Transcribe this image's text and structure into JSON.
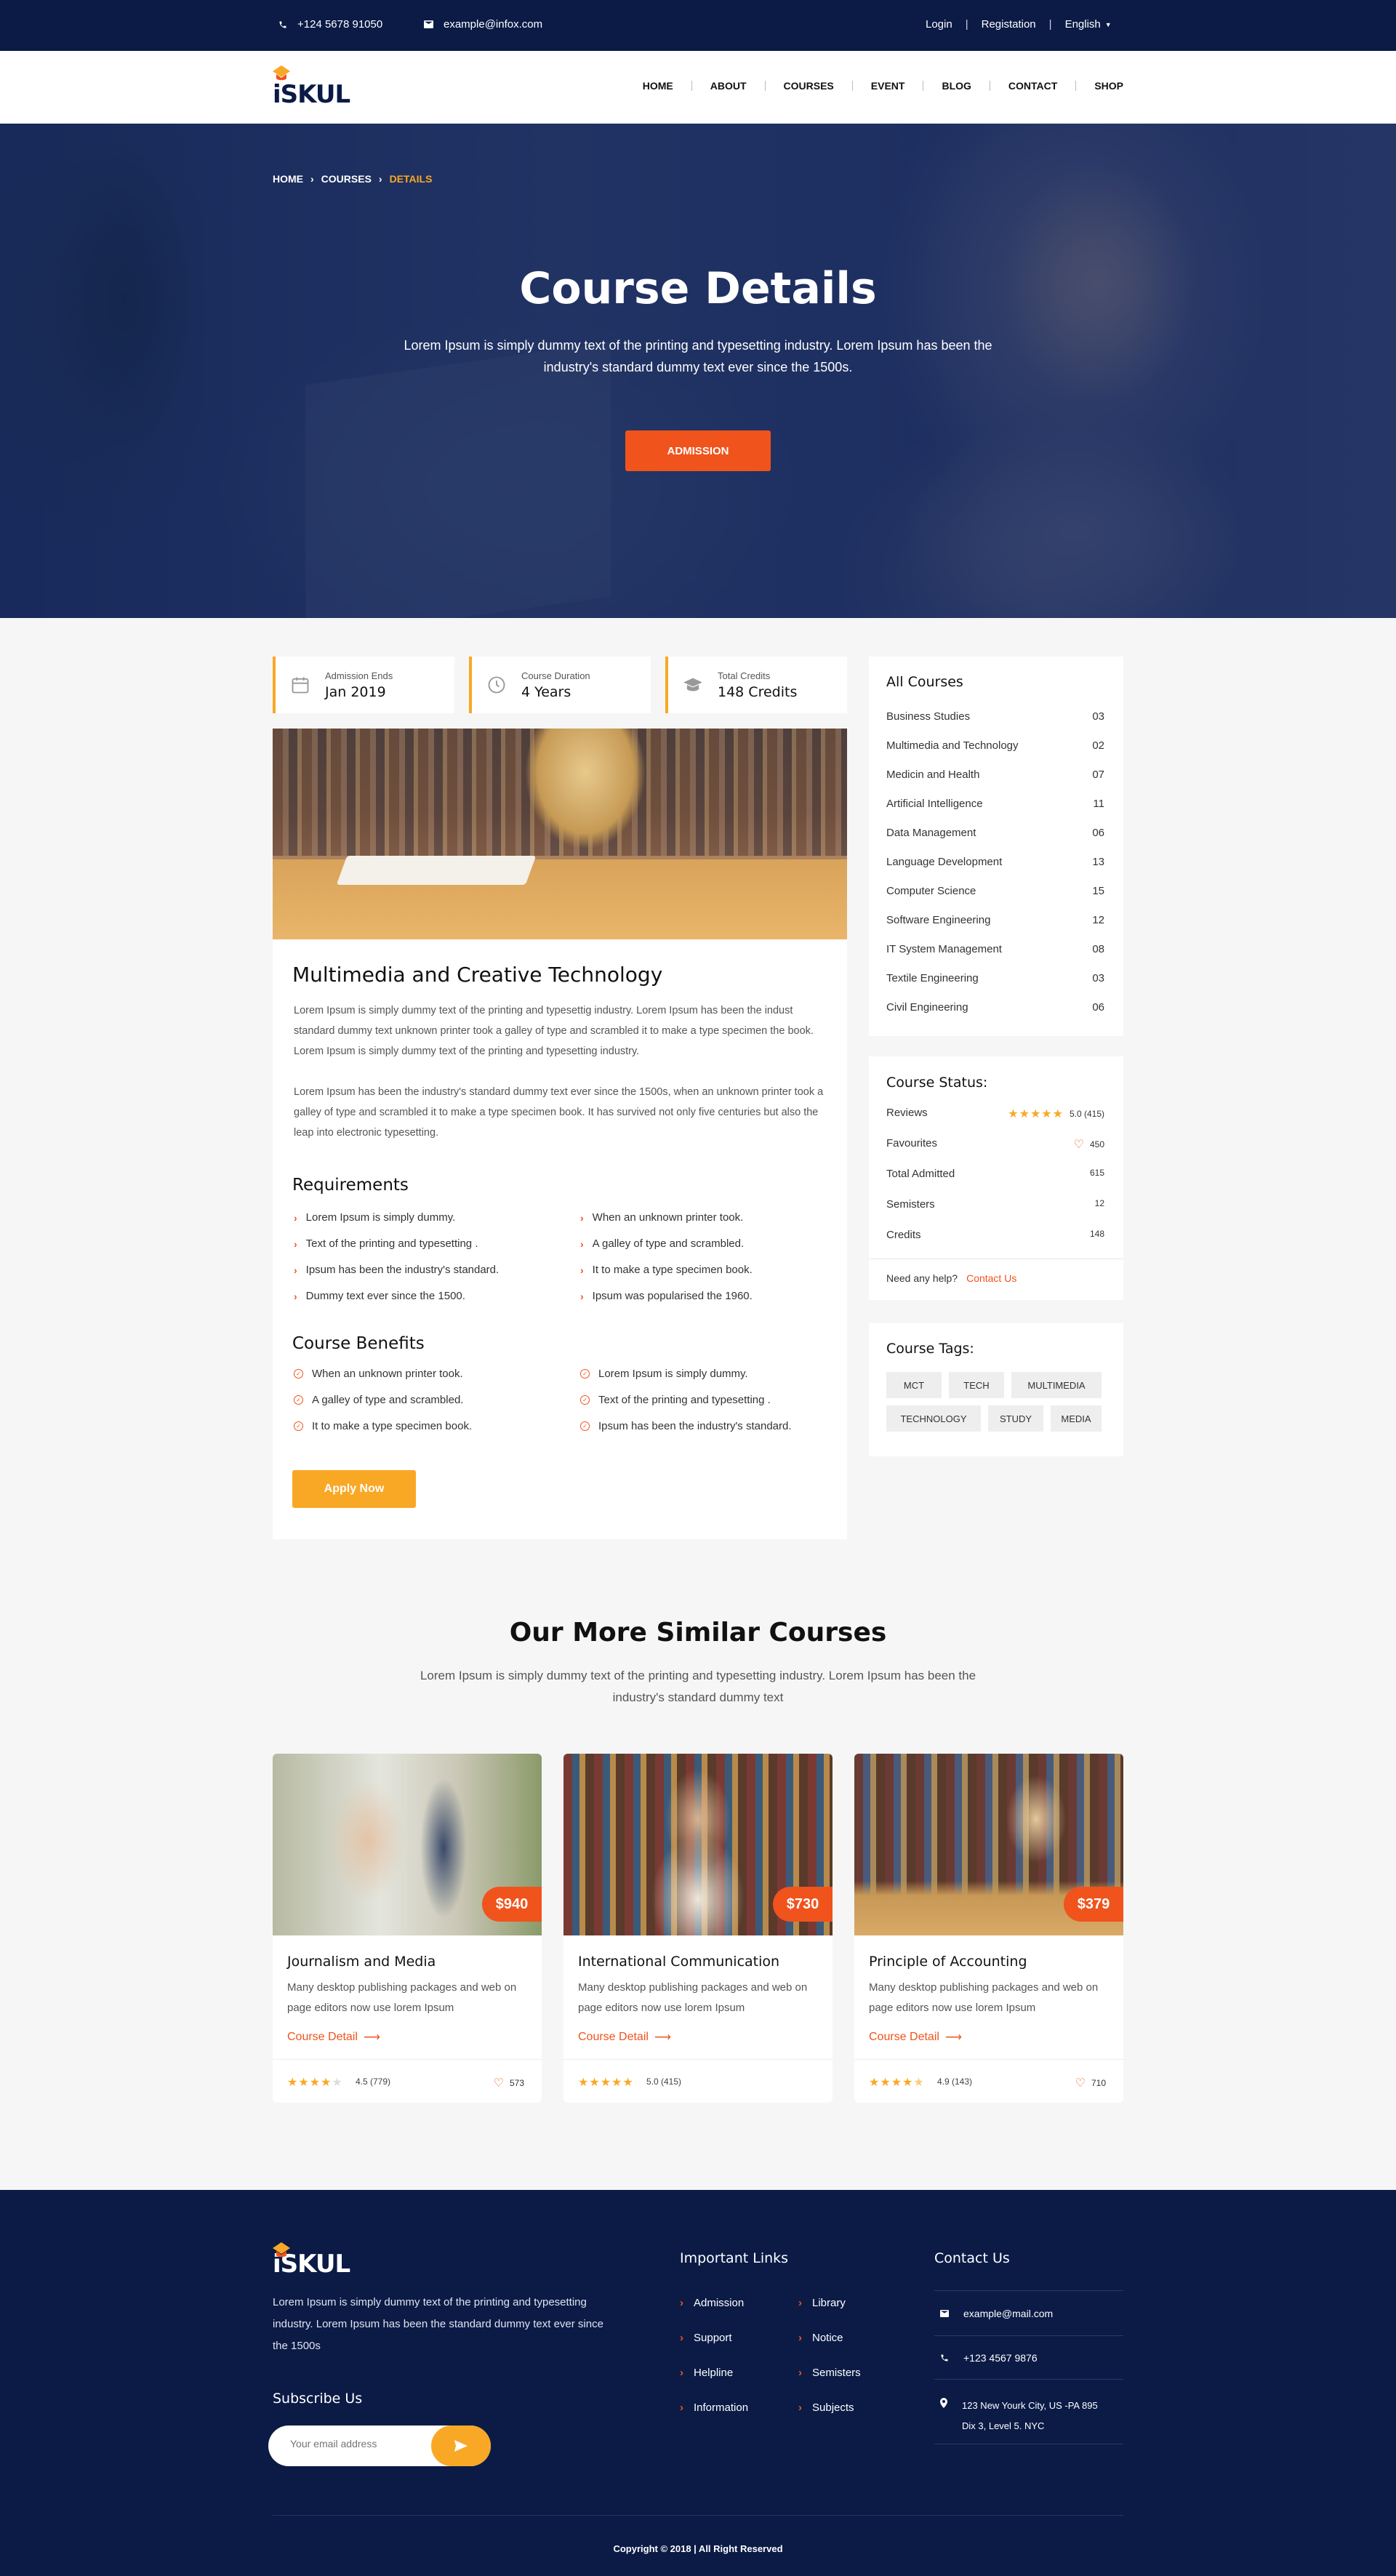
{
  "topbar": {
    "phone": "+124 5678 91050",
    "email": "example@infox.com",
    "login": "Login",
    "registration": "Registation",
    "language": "English"
  },
  "header": {
    "logo_text": "iSKUL",
    "menu": [
      "HOME",
      "ABOUT",
      "COURSES",
      "EVENT",
      "BLOG",
      "CONTACT",
      "SHOP"
    ]
  },
  "hero": {
    "breadcrumb": [
      "HOME",
      "COURSES",
      "DETAILS"
    ],
    "title": "Course Details",
    "subtitle": "Lorem Ipsum is simply dummy text of the printing and typesetting industry. Lorem Ipsum has been the industry's standard dummy text ever since the 1500s.",
    "button": "ADMISSION"
  },
  "info": [
    {
      "label": "Admission Ends",
      "value": "Jan 2019",
      "icon": "calendar-icon"
    },
    {
      "label": "Course Duration",
      "value": "4 Years",
      "icon": "clock-icon"
    },
    {
      "label": "Total Credits",
      "value": "148 Credits",
      "icon": "graduation-cap-icon"
    }
  ],
  "course": {
    "title": "Multimedia and Creative Technology",
    "para1": "Lorem Ipsum is simply dummy text of the printing and typesettig industry. Lorem Ipsum has been the indust standard dummy text unknown printer took a galley of type and scrambled it to make a type specimen the book. Lorem Ipsum is simply dummy text of the printing and typesetting industry.",
    "para2": "Lorem Ipsum has been the industry's standard dummy text ever since the 1500s, when an unknown printer took a galley of type and scrambled it to make a type specimen book. It has survived not only five centuries but also the leap into electronic typesetting.",
    "requirements_title": "Requirements",
    "requirements": [
      "Lorem Ipsum is simply dummy.",
      "Text of the printing and typesetting .",
      "Ipsum has been the industry's standard.",
      "Dummy text ever since the 1500.",
      "When an unknown printer took.",
      "A galley of type and scrambled.",
      "It to make a type specimen book.",
      "Ipsum was popularised the 1960."
    ],
    "benefits_title": "Course Benefits",
    "benefits": [
      "When an unknown printer took.",
      "A galley of type and scrambled.",
      "It to make a type specimen book.",
      "Lorem Ipsum is simply dummy.",
      "Text of the printing and typesetting .",
      "Ipsum has been the industry's standard."
    ],
    "apply": "Apply Now"
  },
  "all_courses": {
    "title": "All Courses",
    "items": [
      {
        "name": "Business Studies",
        "count": "03"
      },
      {
        "name": "Multimedia and Technology",
        "count": "02"
      },
      {
        "name": "Medicin and Health",
        "count": "07"
      },
      {
        "name": "Artificial Intelligence",
        "count": "11"
      },
      {
        "name": "Data Management",
        "count": "06"
      },
      {
        "name": "Language Development",
        "count": "13"
      },
      {
        "name": "Computer Science",
        "count": "15"
      },
      {
        "name": "Software Engineering",
        "count": "12"
      },
      {
        "name": "IT System Management",
        "count": "08"
      },
      {
        "name": "Textile Engineering",
        "count": "03"
      },
      {
        "name": "Civil Engineering",
        "count": "06"
      }
    ]
  },
  "status": {
    "title": "Course Status:",
    "reviews_label": "Reviews",
    "reviews_value": "5.0 (415)",
    "reviews_rating": 5,
    "fav_label": "Favourites",
    "fav_value": "450",
    "admitted_label": "Total Admitted",
    "admitted_value": "615",
    "semisters_label": "Semisters",
    "semisters_value": "12",
    "credits_label": "Credits",
    "credits_value": "148",
    "help": "Need any help?",
    "contact": "Contact Us"
  },
  "tags": {
    "title": "Course Tags:",
    "items": [
      "MCT",
      "TECH",
      "MULTIMEDIA",
      "TECHNOLOGY",
      "STUDY",
      "MEDIA"
    ]
  },
  "similar": {
    "title": "Our More Similar Courses",
    "subtitle": "Lorem Ipsum is simply dummy text of the printing and typesetting industry. Lorem Ipsum has been the industry's standard dummy text",
    "detail_label": "Course Detail",
    "cards": [
      {
        "title": "Journalism and Media",
        "desc": "Many desktop publishing packages and web on page editors now use lorem Ipsum",
        "price": "$940",
        "rating": 4.5,
        "rating_text": "4.5 (779)",
        "likes": "573"
      },
      {
        "title": "International Communication",
        "desc": "Many desktop publishing packages and web on page editors now use lorem Ipsum",
        "price": "$730",
        "rating": 5.0,
        "rating_text": "5.0 (415)",
        "likes": ""
      },
      {
        "title": "Principle of Accounting",
        "desc": "Many desktop publishing packages and web on page editors now use lorem Ipsum",
        "price": "$379",
        "rating": 4.9,
        "rating_text": "4.9 (143)",
        "likes": "710"
      }
    ]
  },
  "footer": {
    "logo_text": "iSKUL",
    "about": "Lorem Ipsum is simply dummy text of the printing and typesetting industry. Lorem Ipsum has been the standard dummy text ever since the 1500s",
    "subscribe_title": "Subscribe Us",
    "email_placeholder": "Your email address",
    "links_title": "Important Links",
    "links_col1": [
      "Admission",
      "Support",
      "Helpline",
      "Information"
    ],
    "links_col2": [
      "Library",
      "Notice",
      "Semisters",
      "Subjects"
    ],
    "contact_title": "Contact Us",
    "contact_email": "example@mail.com",
    "contact_phone": "+123 4567 9876",
    "contact_addr1": "123 New Yourk City, US -PA 895",
    "contact_addr2": "Dix 3, Level 5. NYC",
    "copyright": "Copyright © 2018 |  All Right Reserved"
  },
  "colors": {
    "navy": "#0b1b46",
    "accent_orange": "#f0531c",
    "accent_yellow": "#f9a825"
  }
}
